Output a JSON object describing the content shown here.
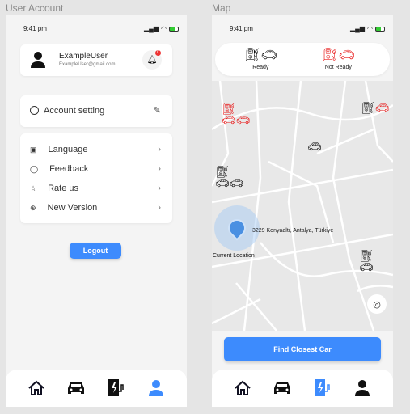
{
  "frames": {
    "left_title": "User Account",
    "right_title": "Map"
  },
  "status": {
    "time": "9:41 pm"
  },
  "account": {
    "username": "ExampleUser",
    "email": "ExampleUser@gmail.com",
    "notification_count": "0",
    "account_setting": "Account setting",
    "menu": [
      {
        "label": "Language",
        "icon": "id-card-icon"
      },
      {
        "label": "Feedback",
        "icon": "chat-icon"
      },
      {
        "label": "Rate us",
        "icon": "star-icon"
      },
      {
        "label": "New Version",
        "icon": "arrow-up-circle-icon"
      }
    ],
    "logout": "Logout"
  },
  "map": {
    "legend": {
      "ready": "Ready",
      "not_ready": "Not Ready"
    },
    "address": "3229  Konyaaltı, Antalya, Türkiye",
    "current_location": "Current Location",
    "find_button": "Find Closest Car"
  },
  "colors": {
    "accent": "#3d8bfd",
    "not_ready": "#e81b1b",
    "ready": "#111111"
  },
  "nav": {
    "left_active": "profile",
    "right_active": "charging"
  }
}
